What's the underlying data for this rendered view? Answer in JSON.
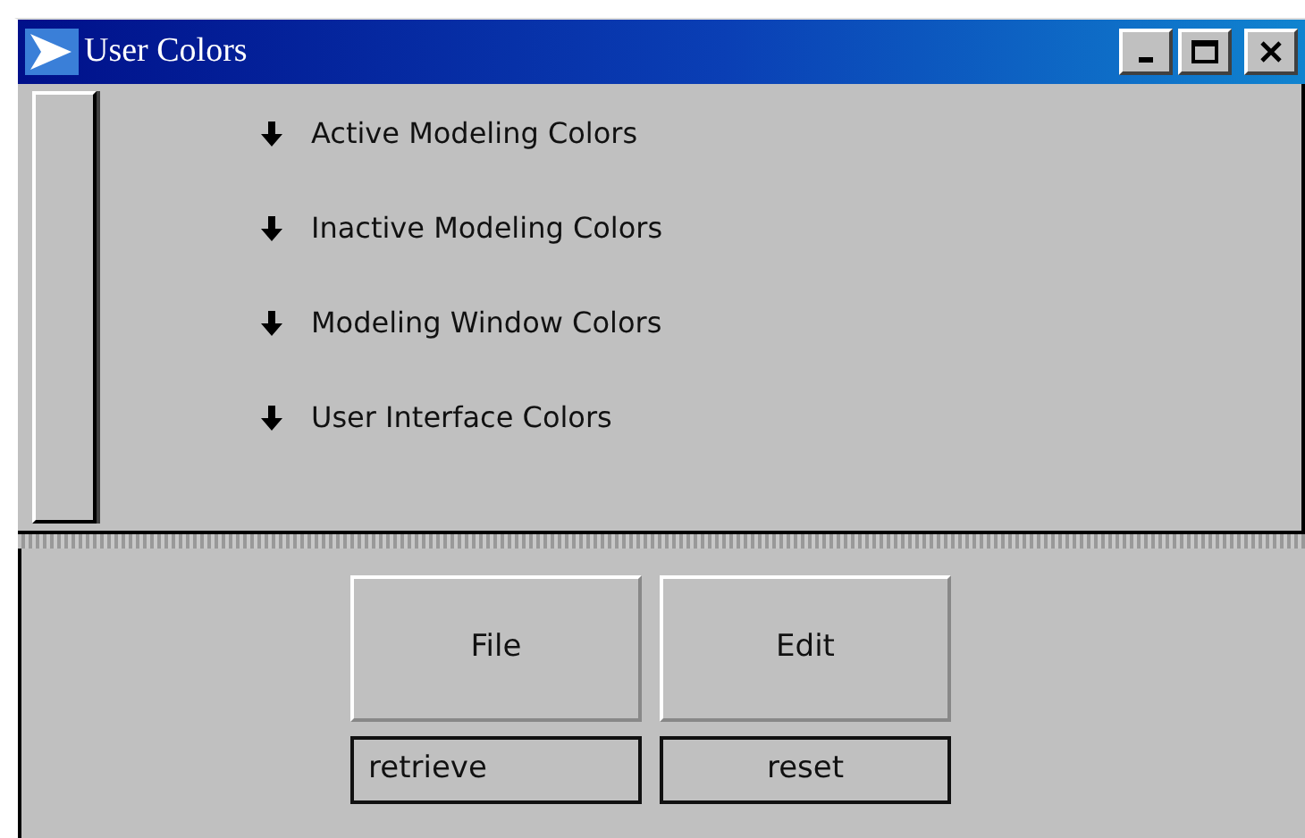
{
  "window": {
    "title": "User Colors"
  },
  "sections": [
    {
      "label": "Active Modeling Colors"
    },
    {
      "label": "Inactive Modeling Colors"
    },
    {
      "label": "Modeling Window Colors"
    },
    {
      "label": "User Interface Colors"
    }
  ],
  "menu_buttons": [
    {
      "label": "File"
    },
    {
      "label": "Edit"
    }
  ],
  "action_buttons": [
    {
      "label": "retrieve"
    },
    {
      "label": "reset"
    }
  ]
}
